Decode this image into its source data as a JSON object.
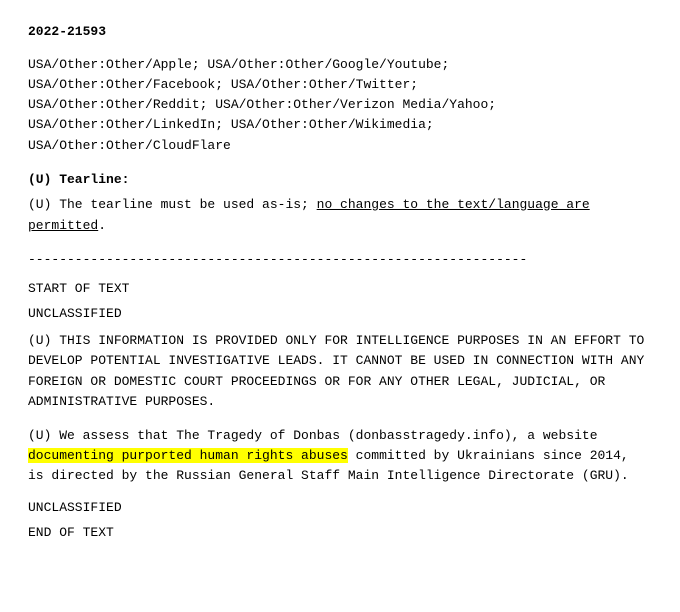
{
  "document": {
    "id": "2022-21593",
    "organizations": [
      "USA/Other:Other/Apple; USA/Other:Other/Google/Youtube;",
      "USA/Other:Other/Facebook; USA/Other:Other/Twitter;",
      "USA/Other:Other/Reddit; USA/Other:Other/Verizon Media/Yahoo;",
      "USA/Other:Other/LinkedIn; USA/Other:Other/Wikimedia;",
      "USA/Other:Other/CloudFlare"
    ],
    "tearline": {
      "label": "(U) Tearline:",
      "text_before_underline": "(U) The tearline must be used as-is; ",
      "underlined_text": "no changes to the text/language are permitted",
      "text_after_underline": "."
    },
    "divider": "----------------------------------------------------------------",
    "sections": [
      {
        "type": "label",
        "text": "START OF TEXT"
      },
      {
        "type": "classification",
        "text": "UNCLASSIFIED"
      },
      {
        "type": "paragraph",
        "text": "(U) THIS INFORMATION IS PROVIDED ONLY FOR INTELLIGENCE PURPOSES IN AN EFFORT TO DEVELOP POTENTIAL INVESTIGATIVE LEADS. IT CANNOT BE USED IN CONNECTION WITH ANY FOREIGN OR DOMESTIC COURT PROCEEDINGS OR FOR ANY OTHER LEGAL, JUDICIAL, OR ADMINISTRATIVE PURPOSES."
      },
      {
        "type": "paragraph_highlighted",
        "text_before": "(U) We assess that The Tragedy of Donbas (donbasstragedy.info), a website ",
        "highlighted": "documenting purported human rights abuses",
        "text_after": " committed by Ukrainians since 2014, is directed by the Russian General Staff Main Intelligence Directorate (GRU)."
      },
      {
        "type": "classification",
        "text": "UNCLASSIFIED"
      },
      {
        "type": "label",
        "text": "END OF TEXT"
      }
    ]
  }
}
